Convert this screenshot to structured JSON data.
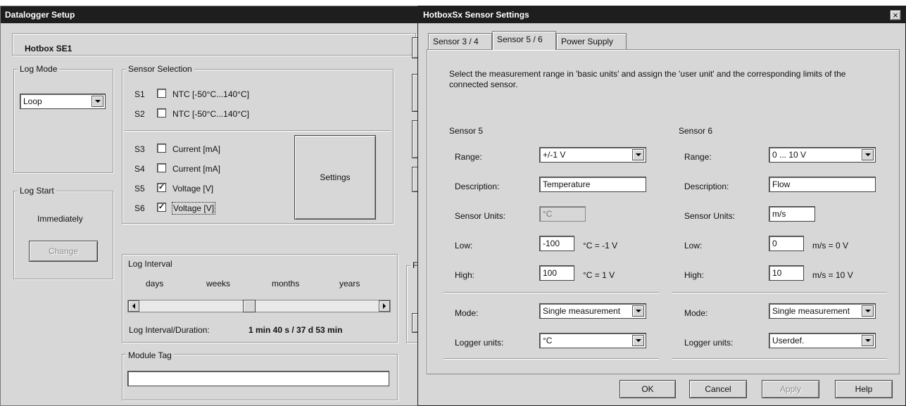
{
  "datalogger": {
    "title": "Datalogger Setup",
    "tab_label": "Hotbox SE1",
    "log_mode": {
      "label": "Log Mode",
      "value": "Loop"
    },
    "sensor_selection": {
      "label": "Sensor Selection",
      "sensors": [
        {
          "id": "S1",
          "checked": false,
          "label": "NTC [-50°C...140°C]"
        },
        {
          "id": "S2",
          "checked": false,
          "label": "NTC [-50°C...140°C]"
        },
        {
          "id": "S3",
          "checked": false,
          "label": "Current [mA]"
        },
        {
          "id": "S4",
          "checked": false,
          "label": "Current [mA]"
        },
        {
          "id": "S5",
          "checked": true,
          "label": "Voltage [V]"
        },
        {
          "id": "S6",
          "checked": true,
          "label": "Voltage [V]"
        }
      ],
      "settings_button": "Settings"
    },
    "log_start": {
      "label": "Log Start",
      "value": "Immediately",
      "change_button": "Change"
    },
    "log_interval": {
      "label": "Log Interval",
      "scale": [
        "days",
        "weeks",
        "months",
        "years"
      ],
      "summary_label": "Log Interval/Duration:",
      "summary_value": "1 min 40 s  / 37 d 53 min",
      "partial_label": "F"
    },
    "module_tag": {
      "label": "Module Tag",
      "value": ""
    }
  },
  "sensor_dialog": {
    "title": "HotboxSx Sensor Settings",
    "close_glyph": "×",
    "tabs": [
      "Sensor 3 / 4",
      "Sensor 5 / 6",
      "Power Supply"
    ],
    "active_tab": 1,
    "instructions": "Select the measurement range in 'basic units' and assign the 'user unit' and the corresponding limits of the connected sensor.",
    "labels": {
      "range": "Range:",
      "description": "Description:",
      "sensor_units": "Sensor Units:",
      "low": "Low:",
      "high": "High:",
      "mode": "Mode:",
      "logger_units": "Logger units:"
    },
    "sensor5": {
      "title": "Sensor 5",
      "range": "+/-1 V",
      "description": "Temperature",
      "sensor_units": "°C",
      "low": "-100",
      "low_hint": "°C = -1 V",
      "high": "100",
      "high_hint": "°C = 1 V",
      "mode": "Single measurement",
      "logger_units": "°C"
    },
    "sensor6": {
      "title": "Sensor 6",
      "range": "0 ... 10 V",
      "description": "Flow",
      "sensor_units": "m/s",
      "low": "0",
      "low_hint": "m/s = 0 V",
      "high": "10",
      "high_hint": "m/s = 10 V",
      "mode": "Single measurement",
      "logger_units": "Userdef."
    },
    "buttons": {
      "ok": "OK",
      "cancel": "Cancel",
      "apply": "Apply",
      "help": "Help"
    }
  }
}
